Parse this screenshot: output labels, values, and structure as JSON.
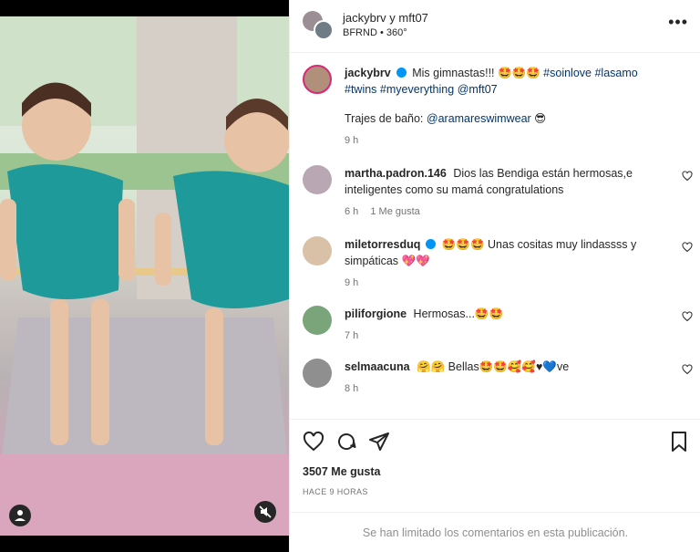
{
  "post": {
    "header": {
      "user": "jackybrv y mft07",
      "subtitle": "BFRND • 360°",
      "more": "•••"
    },
    "caption": {
      "username": "jackybrv",
      "text_part1": "Mis gimnastas!!! 🤩🤩🤩",
      "hashtags": "#soinlove #lasamo #twins #myeverything",
      "mention": "@mft07",
      "line2_label": "Trajes de baño:",
      "line2_mention": "@aramareswimwear",
      "line2_emoji": "😎",
      "time": "9 h"
    },
    "comments": [
      {
        "username": "martha.padron.146",
        "text": "Dios las Bendiga están hermosas,e inteligentes como su mamá congratulations",
        "time": "6 h",
        "likes": "1 Me gusta",
        "verified": false
      },
      {
        "username": "miletorresduq",
        "text": "🤩🤩🤩 Unas cositas muy lindassss y simpáticas 💖💖",
        "time": "9 h",
        "likes": "",
        "verified": true
      },
      {
        "username": "piliforgione",
        "text": "Hermosas...🤩🤩",
        "time": "7 h",
        "likes": "",
        "verified": false
      },
      {
        "username": "selmaacuna",
        "text": "🤗🤗 Bellas🤩🤩🥰🥰♥💙ve",
        "time": "8 h",
        "likes": "",
        "verified": false
      }
    ],
    "likes": "3507 Me gusta",
    "when": "HACE 9 HORAS",
    "limited_notice": "Se han limitado los comentarios en esta publicación.",
    "colors": {
      "link": "#00376b",
      "verified": "#0095f6",
      "muted": "#737373"
    },
    "icons": [
      "heart-icon",
      "comment-icon",
      "share-icon",
      "bookmark-icon",
      "more-icon",
      "user-tag-icon",
      "mute-icon"
    ]
  }
}
